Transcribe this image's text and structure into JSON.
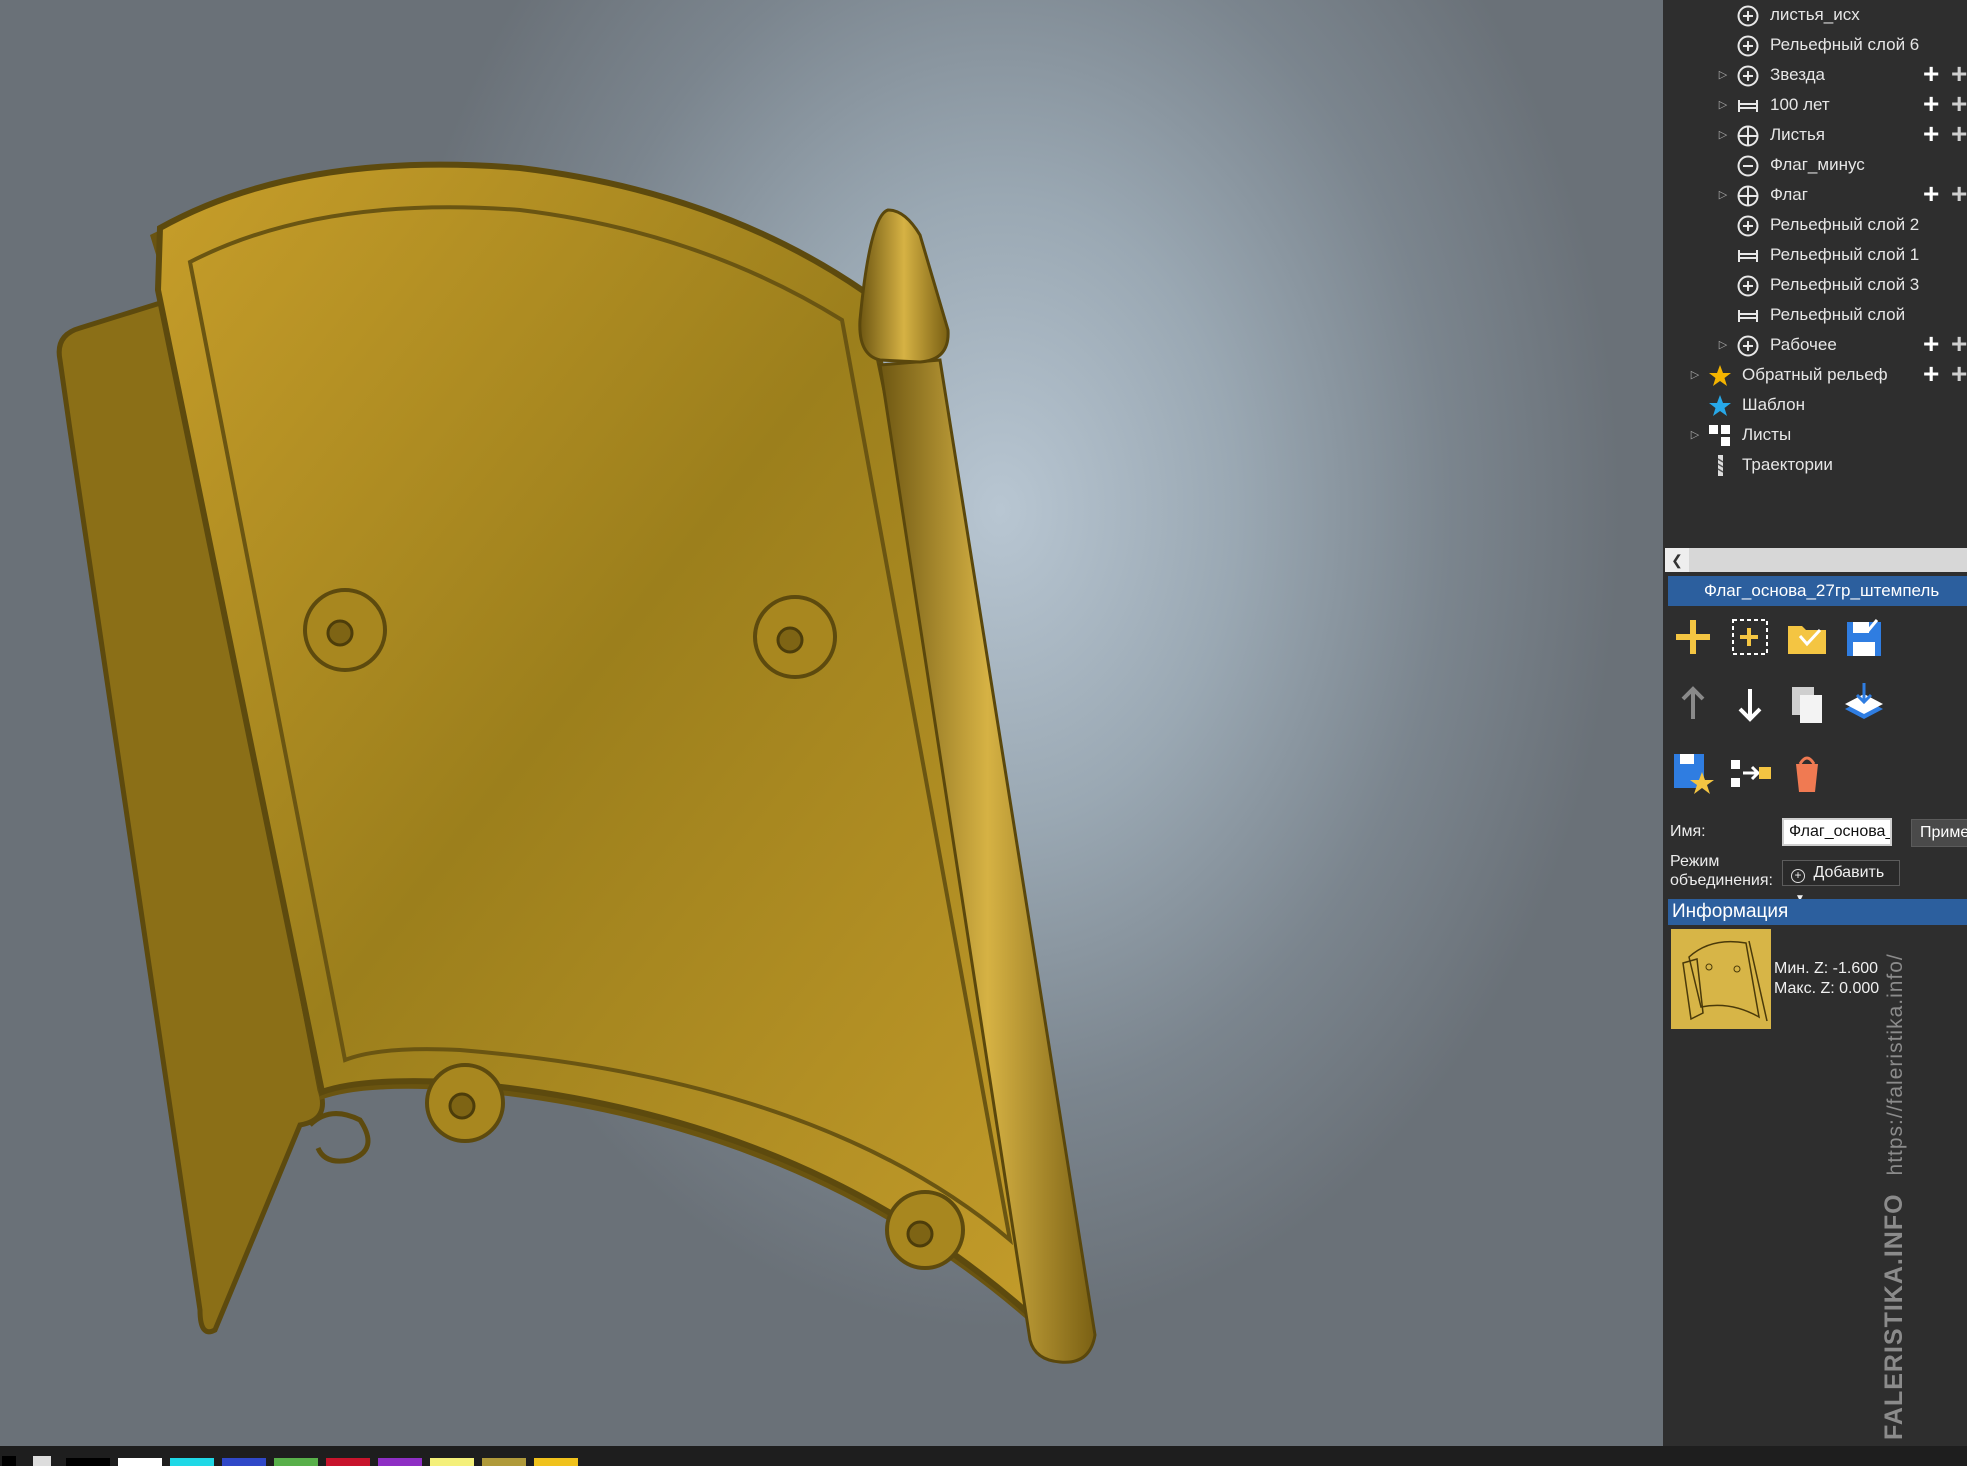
{
  "tree": [
    {
      "label": "листья_исх",
      "icon": "plus-circle-icon",
      "expandable": false,
      "add": false
    },
    {
      "label": "Рельефный слой 6",
      "icon": "plus-circle-icon",
      "expandable": false,
      "add": false
    },
    {
      "label": "Звезда",
      "icon": "plus-circle-icon",
      "expandable": true,
      "add": true
    },
    {
      "label": "100 лет",
      "icon": "merge-bar-icon",
      "expandable": true,
      "add": true
    },
    {
      "label": "Листья",
      "icon": "cross-circle-icon",
      "expandable": true,
      "add": true
    },
    {
      "label": "Флаг_минус",
      "icon": "minus-circle-icon",
      "expandable": false,
      "add": false
    },
    {
      "label": "Флаг",
      "icon": "cross-circle-icon",
      "expandable": true,
      "add": true
    },
    {
      "label": "Рельефный слой 2",
      "icon": "plus-circle-icon",
      "expandable": false,
      "add": false
    },
    {
      "label": "Рельефный слой 1",
      "icon": "merge-bar-icon",
      "expandable": false,
      "add": false
    },
    {
      "label": "Рельефный слой 3",
      "icon": "plus-circle-icon",
      "expandable": false,
      "add": false
    },
    {
      "label": "Рельефный слой",
      "icon": "merge-bar-icon",
      "expandable": false,
      "add": false
    },
    {
      "label": "Рабочее",
      "icon": "plus-circle-icon",
      "expandable": true,
      "add": true
    }
  ],
  "root_items": [
    {
      "label": "Обратный рельеф",
      "icon": "star-gold-icon",
      "expandable": true,
      "add": true
    },
    {
      "label": "Шаблон",
      "icon": "star-blue-icon",
      "expandable": false,
      "add": false
    },
    {
      "label": "Листы",
      "icon": "sheets-icon",
      "expandable": true,
      "add": false
    },
    {
      "label": "Траектории",
      "icon": "toolpath-icon",
      "expandable": false,
      "add": false
    }
  ],
  "panel": {
    "layer_title": "Флаг_основа_27гр_штемпель",
    "name_label": "Имя:",
    "name_value": "Флаг_основа_",
    "apply_label": "Приме",
    "mode_label_1": "Режим",
    "mode_label_2": "объединения:",
    "mode_value": "Добавить",
    "info_title": "Информация",
    "min_z": "Мин. Z: -1.600",
    "max_z": "Макс. Z: 0.000"
  },
  "toolbar_icons": [
    [
      "add-layer-icon",
      "add-selection-icon",
      "load-folder-icon",
      "save-disk-icon"
    ],
    [
      "move-up-icon",
      "move-down-icon",
      "duplicate-icon",
      "merge-down-icon"
    ],
    [
      "save-template-icon",
      "transfer-icon",
      "delete-bucket-icon"
    ]
  ],
  "palette": [
    "#000000",
    "#ffffff",
    "#1fd8e6",
    "#3048c8",
    "#58b04a",
    "#c8142c",
    "#8e2fc4",
    "#f4f07a",
    "#b09a3a",
    "#f0c21c"
  ],
  "colors": {
    "accent": "#2c5f9e",
    "relief": "#b08e24"
  },
  "watermark": {
    "brand": "FALERISTIKA.INFO",
    "url": "https://faleristika.info/"
  }
}
